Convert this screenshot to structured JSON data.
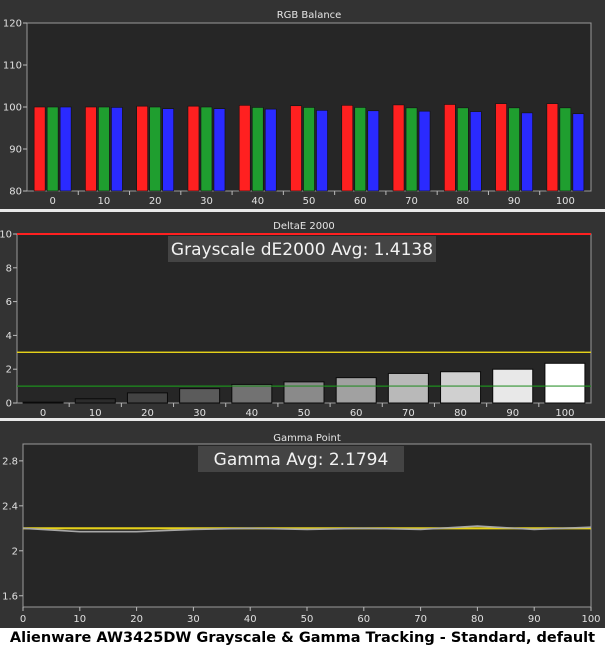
{
  "caption": "Alienware AW3425DW Grayscale & Gamma Tracking - Standard, default",
  "colors": {
    "red": "#ff2020",
    "green": "#1f9e2f",
    "blue": "#2a2aff",
    "yellow": "#e5d11a",
    "darkgreen": "#1e8a1e",
    "panel": "#333333",
    "plot": "#262626"
  },
  "chart_data": [
    {
      "type": "bar",
      "title": "RGB Balance",
      "categories": [
        "0",
        "10",
        "20",
        "30",
        "40",
        "50",
        "60",
        "70",
        "80",
        "90",
        "100"
      ],
      "ylim": [
        80,
        120
      ],
      "yticks": [
        "80",
        "90",
        "100",
        "110",
        "120"
      ],
      "series": [
        {
          "color": "red",
          "values": [
            100,
            100,
            100.2,
            100.2,
            100.4,
            100.3,
            100.4,
            100.5,
            100.6,
            100.8,
            100.8
          ]
        },
        {
          "color": "green",
          "values": [
            100,
            100,
            100,
            100,
            99.9,
            99.9,
            99.9,
            99.8,
            99.8,
            99.8,
            99.8
          ]
        },
        {
          "color": "blue",
          "values": [
            100,
            99.9,
            99.6,
            99.6,
            99.5,
            99.2,
            99.1,
            99,
            98.9,
            98.6,
            98.4
          ]
        }
      ]
    },
    {
      "type": "bar",
      "title": "DeltaE 2000",
      "annotation": "Grayscale dE2000 Avg: 1.4138",
      "categories": [
        "0",
        "10",
        "20",
        "30",
        "40",
        "50",
        "60",
        "70",
        "80",
        "90",
        "100"
      ],
      "ylim": [
        0,
        10
      ],
      "yticks": [
        "0",
        "2",
        "4",
        "6",
        "8",
        "10"
      ],
      "values": [
        0.05,
        0.25,
        0.6,
        0.85,
        1.1,
        1.25,
        1.5,
        1.75,
        1.85,
        2.0,
        2.35
      ],
      "reference_lines": [
        {
          "value": 3,
          "color": "yellow"
        },
        {
          "value": 1,
          "color": "darkgreen"
        },
        {
          "value": 10,
          "color": "red"
        }
      ]
    },
    {
      "type": "line",
      "title": "Gamma Point",
      "annotation": "Gamma Avg: 2.1794",
      "x": [
        0,
        10,
        20,
        30,
        40,
        50,
        60,
        70,
        80,
        90,
        100
      ],
      "xticks": [
        "0",
        "10",
        "20",
        "30",
        "40",
        "50",
        "60",
        "70",
        "80",
        "90",
        "100"
      ],
      "ylim": [
        1.5,
        2.95
      ],
      "yticks": [
        "1.6",
        "2",
        "2.4",
        "2.8"
      ],
      "target": 2.2,
      "values": [
        2.2,
        2.17,
        2.17,
        2.19,
        2.2,
        2.19,
        2.2,
        2.19,
        2.22,
        2.19,
        2.21
      ]
    }
  ]
}
